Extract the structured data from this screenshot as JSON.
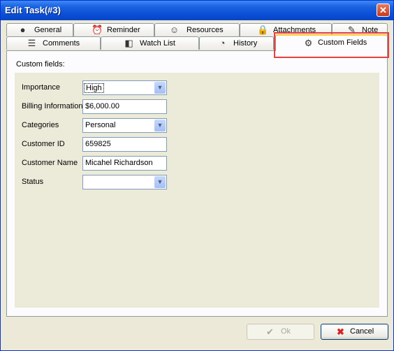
{
  "window": {
    "title": "Edit Task(#3)",
    "close_glyph": "✕"
  },
  "tabs_row1": [
    {
      "label": "General",
      "icon": "globe-icon",
      "glyph": "●"
    },
    {
      "label": "Reminder",
      "icon": "alarm-clock-icon",
      "glyph": "⏰"
    },
    {
      "label": "Resources",
      "icon": "person-icon",
      "glyph": "☺"
    },
    {
      "label": "Attachments",
      "icon": "lock-icon",
      "glyph": "🔒"
    },
    {
      "label": "Note",
      "icon": "note-icon",
      "glyph": "✎"
    }
  ],
  "tabs_row2": [
    {
      "label": "Comments",
      "icon": "comments-icon",
      "glyph": "☰"
    },
    {
      "label": "Watch List",
      "icon": "watch-list-icon",
      "glyph": "◧"
    },
    {
      "label": "History",
      "icon": "history-icon",
      "glyph": "◔"
    },
    {
      "label": "Custom Fields",
      "icon": "gear-icon",
      "glyph": "⚙",
      "active": true
    }
  ],
  "custom_fields": {
    "section_label": "Custom fields:",
    "fields": [
      {
        "label": "Importance",
        "value": "High",
        "type": "combo"
      },
      {
        "label": "Billing Information",
        "value": "$6,000.00",
        "type": "text"
      },
      {
        "label": "Categories",
        "value": "Personal",
        "type": "combo"
      },
      {
        "label": "Customer ID",
        "value": "659825",
        "type": "text"
      },
      {
        "label": "Customer Name",
        "value": "Micahel Richardson",
        "type": "text"
      },
      {
        "label": "Status",
        "value": "",
        "type": "combo"
      }
    ],
    "dropdown_glyph": "▼"
  },
  "buttons": {
    "ok": {
      "label": "Ok",
      "icon": "checkmark-icon",
      "glyph": "✔",
      "enabled": false
    },
    "cancel": {
      "label": "Cancel",
      "icon": "x-icon",
      "glyph": "✖"
    }
  }
}
